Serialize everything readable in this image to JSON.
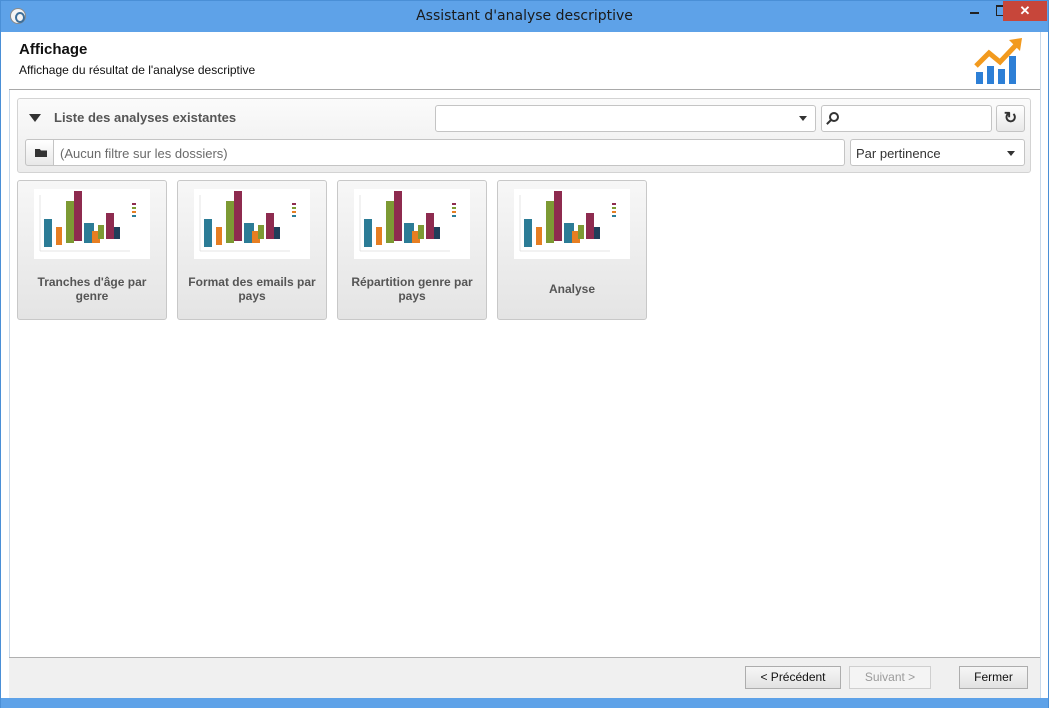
{
  "window": {
    "title": "Assistant d'analyse descriptive",
    "close_glyph": "✕",
    "accent_color": "#5ea2e8"
  },
  "header": {
    "title": "Affichage",
    "subtitle": "Affichage du résultat de l'analyse descriptive",
    "logo_icon": "trend-chart-icon"
  },
  "panel": {
    "title": "Liste des analyses existantes",
    "folder_combo_value": "",
    "search_value": "",
    "refresh_glyph": "↻",
    "folder_filter_text": "(Aucun filtre sur les dossiers)",
    "sort_value": "Par pertinence"
  },
  "tiles": [
    {
      "label": "Tranches d'âge par genre",
      "icon": "bar-chart-thumbnail"
    },
    {
      "label": "Format des emails par pays",
      "icon": "bar-chart-thumbnail"
    },
    {
      "label": "Répartition genre par pays",
      "icon": "bar-chart-thumbnail"
    },
    {
      "label": "Analyse",
      "icon": "bar-chart-thumbnail"
    }
  ],
  "footer": {
    "prev_label": "< Précédent",
    "next_label": "Suivant >",
    "close_label": "Fermer"
  }
}
